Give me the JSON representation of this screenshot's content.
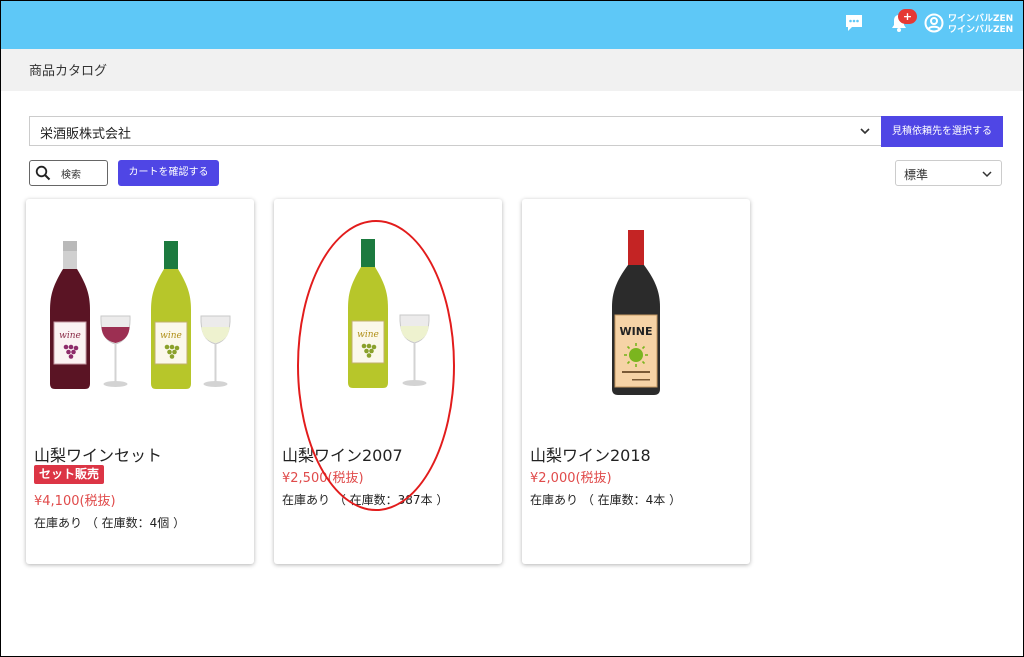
{
  "header": {
    "notification_count": "+",
    "user_line1": "ワインバルZEN",
    "user_line2": "ワインバルZEN"
  },
  "page": {
    "title": "商品カタログ"
  },
  "supplier": {
    "selected": "栄酒販株式会社",
    "button_label": "見積依頼先を選択する"
  },
  "toolbar": {
    "search_label": "検索",
    "cart_label": "カートを確認する",
    "sort_selected": "標準"
  },
  "products": [
    {
      "name": "山梨ワインセット",
      "tag": "セット販売",
      "price": "¥4,100(税抜)",
      "stock": "在庫あり （ 在庫数：4個 ）"
    },
    {
      "name": "山梨ワイン2007",
      "price": "¥2,500(税抜)",
      "stock": "在庫あり （ 在庫数：387本 ）"
    },
    {
      "name": "山梨ワイン2018",
      "price": "¥2,000(税抜)",
      "stock": "在庫あり （ 在庫数：4本 ）"
    }
  ],
  "label_text": {
    "wine_script": "wine",
    "wine_caps": "WINE"
  },
  "colors": {
    "header": "#5ec8f7",
    "primary_button": "#4f46e5",
    "price": "#e04b4b",
    "tag": "#dc3545",
    "annotation": "#e21c1c"
  },
  "icons": [
    "chat-icon",
    "bell-icon",
    "user-circle-icon",
    "chevron-down-icon",
    "search-icon"
  ]
}
